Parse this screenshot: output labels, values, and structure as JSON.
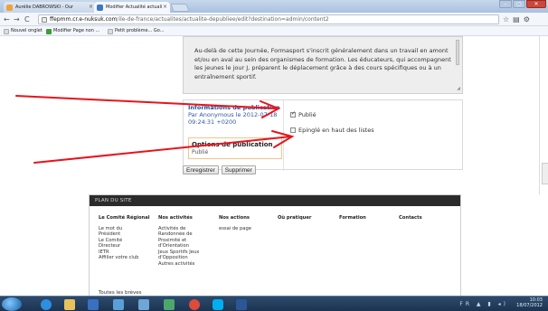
{
  "browser": {
    "tabs": [
      {
        "label": "Aurélie DABROWSKI - Our",
        "active": false,
        "icon": "user-icon"
      },
      {
        "label": "Modifier Actualité actuali",
        "active": true,
        "icon": "page-icon"
      }
    ],
    "address": {
      "domain": "ffepmm.cr.e-nuksuk.com",
      "path": "/ile-de-france/actualites/actualite-depubliee/edit?destination=admin/content2"
    },
    "bookmarks": [
      {
        "label": "Nouvel onglet",
        "icon": "page-icon"
      },
      {
        "label": "Modifier Page non ...",
        "icon": "leaf-icon"
      },
      {
        "label": "Petit problème... Go...",
        "icon": "page-icon"
      }
    ]
  },
  "editor": {
    "body_text": "Au-delà de cette Journée, Formasport s'inscrit généralement dans un travail en amont et/ou en aval au sein des organismes de formation. Les éducateurs, qui accompagnent les jeunes le jour J, préparent le déplacement grâce à des cours spécifiques ou à un entraînement sportif."
  },
  "vertical_tabs": {
    "tab1_title": "Informations de publication",
    "tab1_summary_line1": "Par Anonymous le 2012-07-18",
    "tab1_summary_line2": "09:24:31 +0200",
    "tab2_title": "Options de publication",
    "tab2_summary": "Publié"
  },
  "options": {
    "published_label": "Publié",
    "published_checked": true,
    "sticky_label": "Epinglé en haut des listes",
    "sticky_checked": false
  },
  "buttons": {
    "save": "Enregistrer",
    "delete": "Supprimer"
  },
  "footer": {
    "heading": "PLAN DU SITE",
    "columns": [
      {
        "title": "Le Comité Régional",
        "items": [
          "Le mot du",
          "Président",
          "Le Comité",
          "Directeur",
          "IETR",
          "Affilier votre club"
        ]
      },
      {
        "title": "Nos activités",
        "items": [
          "Activités de",
          "Randonnée de",
          "Proximité et",
          "d'Orientation",
          "Jeux Sportifs Jeux",
          "d'Opposition",
          "Autres activités"
        ]
      },
      {
        "title": "Nos actions",
        "items": [
          "essai de page"
        ]
      },
      {
        "title": "Où pratiquer",
        "items": []
      },
      {
        "title": "Formation",
        "items": []
      },
      {
        "title": "Contacts",
        "items": []
      }
    ],
    "all_briefs": "Toutes les brèves"
  },
  "taskbar": {
    "time": "10:03",
    "date": "18/07/2012",
    "lang": "FR"
  },
  "colors": {
    "arrow": "#e8141b",
    "link": "#2f57a6",
    "footer_header": "#2b2b2b"
  }
}
